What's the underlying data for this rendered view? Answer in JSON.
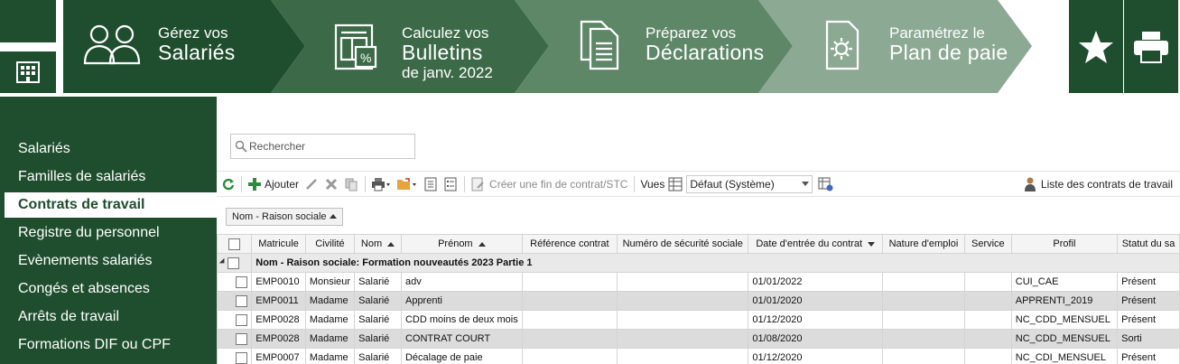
{
  "ribbon": {
    "steps": [
      {
        "line1": "Gérez vos",
        "line2": "Salariés",
        "line3": "",
        "icon": "users-icon"
      },
      {
        "line1": "Calculez vos",
        "line2": "Bulletins",
        "line3": "de janv. 2022",
        "icon": "payslip-icon"
      },
      {
        "line1": "Préparez vos",
        "line2": "Déclarations",
        "line3": "",
        "icon": "documents-icon"
      },
      {
        "line1": "Paramétrez le",
        "line2": "Plan de paie",
        "line3": "",
        "icon": "settings-document-icon"
      }
    ],
    "colors": {
      "step1": "#1f4e2e",
      "step2": "#3c6a48",
      "step3": "#5e8768",
      "step4": "#8ca994"
    }
  },
  "sidebar": {
    "items": [
      {
        "label": "Salariés"
      },
      {
        "label": "Familles de salariés"
      },
      {
        "label": "Contrats de travail",
        "active": true
      },
      {
        "label": "Registre du personnel"
      },
      {
        "label": "Evènements salariés"
      },
      {
        "label": "Congés et absences"
      },
      {
        "label": "Arrêts de travail"
      },
      {
        "label": "Formations DIF ou CPF"
      }
    ]
  },
  "search": {
    "placeholder": "Rechercher"
  },
  "toolbar": {
    "add_label": "Ajouter",
    "end_contract_label": "Créer une fin de contrat/STC",
    "views_label": "Vues",
    "view_selected": "Défaut (Système)",
    "list_label": "Liste des contrats de travail"
  },
  "grouping": {
    "chip_label": "Nom - Raison sociale"
  },
  "table": {
    "columns": [
      "Matricule",
      "Civilité",
      "Nom",
      "Prénom",
      "Référence contrat",
      "Numéro de sécurité sociale",
      "Date d'entrée du contrat",
      "Nature d'emploi",
      "Service",
      "Profil",
      "Statut du sa"
    ],
    "group_row": "Nom - Raison sociale: Formation nouveautés 2023 Partie 1",
    "rows": [
      {
        "matricule": "EMP0010",
        "civilite": "Monsieur",
        "nom": "Salarié",
        "prenom": "adv",
        "reference": "",
        "secu": "",
        "date": "01/01/2022",
        "nature": "",
        "service": "",
        "profil": "CUI_CAE",
        "statut": "Présent"
      },
      {
        "matricule": "EMP0011",
        "civilite": "Madame",
        "nom": "Salarié",
        "prenom": "Apprenti",
        "reference": "",
        "secu": "",
        "date": "01/01/2020",
        "nature": "",
        "service": "",
        "profil": "APPRENTI_2019",
        "statut": "Présent"
      },
      {
        "matricule": "EMP0028",
        "civilite": "Madame",
        "nom": "Salarié",
        "prenom": "CDD moins de deux mois",
        "reference": "",
        "secu": "",
        "date": "01/12/2020",
        "nature": "",
        "service": "",
        "profil": "NC_CDD_MENSUEL",
        "statut": "Présent"
      },
      {
        "matricule": "EMP0028",
        "civilite": "Madame",
        "nom": "Salarié",
        "prenom": "CONTRAT COURT",
        "reference": "",
        "secu": "",
        "date": "01/08/2020",
        "nature": "",
        "service": "",
        "profil": "NC_CDD_MENSUEL",
        "statut": "Sorti"
      },
      {
        "matricule": "EMP0007",
        "civilite": "Madame",
        "nom": "Salarié",
        "prenom": "Décalage de paie",
        "reference": "",
        "secu": "",
        "date": "01/12/2020",
        "nature": "",
        "service": "",
        "profil": "NC_CDI_MENSUEL",
        "statut": "Présent"
      }
    ]
  }
}
